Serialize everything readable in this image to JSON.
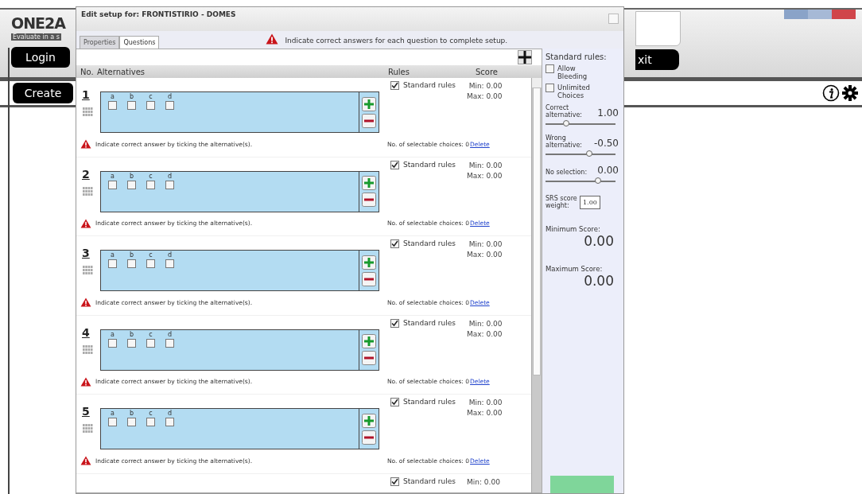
{
  "app": {
    "logo": "ONE2A",
    "tagline": "Evaluate in a s",
    "buttons": {
      "login": "Login",
      "create": "Create",
      "exit": "xit"
    }
  },
  "dialog": {
    "title": "Edit setup for: FRONTISTIRIO - DOMES",
    "tabs": [
      {
        "label": "Properties",
        "selected": false
      },
      {
        "label": "Questions",
        "selected": true
      }
    ],
    "message": "Indicate correct answers for each question to complete setup.",
    "columns": {
      "number": "No.",
      "alternatives": "Alternatives",
      "rules": "Rules",
      "score": "Score"
    },
    "questions": [
      {
        "number": "1",
        "rules_label": "Standard rules",
        "alternatives": [
          {
            "label": "a",
            "checked": false
          },
          {
            "label": "b",
            "checked": false
          },
          {
            "label": "c",
            "checked": false
          },
          {
            "label": "d",
            "checked": false
          }
        ],
        "standard_rules": true,
        "min": "Min: 0.00",
        "max": "Max: 0.00",
        "warning": "Indicate correct answer by ticking the alternative(s).",
        "choices": "No. of selectable choices: 0",
        "delete": "Delete"
      },
      {
        "number": "2",
        "rules_label": "Standard rules",
        "alternatives": [
          {
            "label": "a",
            "checked": false
          },
          {
            "label": "b",
            "checked": false
          },
          {
            "label": "c",
            "checked": false
          },
          {
            "label": "d",
            "checked": false
          }
        ],
        "standard_rules": true,
        "min": "Min: 0.00",
        "max": "Max: 0.00",
        "warning": "Indicate correct answer by ticking the alternative(s).",
        "choices": "No. of selectable choices: 0",
        "delete": "Delete"
      },
      {
        "number": "3",
        "rules_label": "Standard rules",
        "alternatives": [
          {
            "label": "a",
            "checked": false
          },
          {
            "label": "b",
            "checked": false
          },
          {
            "label": "c",
            "checked": false
          },
          {
            "label": "d",
            "checked": false
          }
        ],
        "standard_rules": true,
        "min": "Min: 0.00",
        "max": "Max: 0.00",
        "warning": "Indicate correct answer by ticking the alternative(s).",
        "choices": "No. of selectable choices: 0",
        "delete": "Delete"
      },
      {
        "number": "4",
        "rules_label": "Standard rules",
        "alternatives": [
          {
            "label": "a",
            "checked": false
          },
          {
            "label": "b",
            "checked": false
          },
          {
            "label": "c",
            "checked": false
          },
          {
            "label": "d",
            "checked": false
          }
        ],
        "standard_rules": true,
        "min": "Min: 0.00",
        "max": "Max: 0.00",
        "warning": "Indicate correct answer by ticking the alternative(s).",
        "choices": "No. of selectable choices: 0",
        "delete": "Delete"
      },
      {
        "number": "5",
        "rules_label": "Standard rules",
        "alternatives": [
          {
            "label": "a",
            "checked": false
          },
          {
            "label": "b",
            "checked": false
          },
          {
            "label": "c",
            "checked": false
          },
          {
            "label": "d",
            "checked": false
          }
        ],
        "standard_rules": true,
        "min": "Min: 0.00",
        "max": "Max: 0.00",
        "warning": "Indicate correct answer by ticking the alternative(s).",
        "choices": "No. of selectable choices: 0",
        "delete": "Delete"
      },
      {
        "standard_rules": true,
        "rules_label": "Standard rules",
        "min": "Min: 0.00"
      }
    ],
    "rules": {
      "heading": "Standard rules:",
      "options": [
        {
          "label": "Allow Bleeding",
          "checked": false
        },
        {
          "label": "Unlimited Choices",
          "checked": false
        }
      ],
      "sliders": [
        {
          "label": "Correct alternative:",
          "value": "1.00",
          "level": 0.3
        },
        {
          "label": "Wrong alternative:",
          "value": "-0.50",
          "level": 0.62
        },
        {
          "label": "No selection:",
          "value": "0.00",
          "level": 0.75
        }
      ],
      "weight_label": "SRS score weight:",
      "weight_value": "1.00",
      "min_label": "Minimum Score:",
      "min_value": "0.00",
      "max_label": "Maximum Score:",
      "max_value": "0.00"
    }
  }
}
